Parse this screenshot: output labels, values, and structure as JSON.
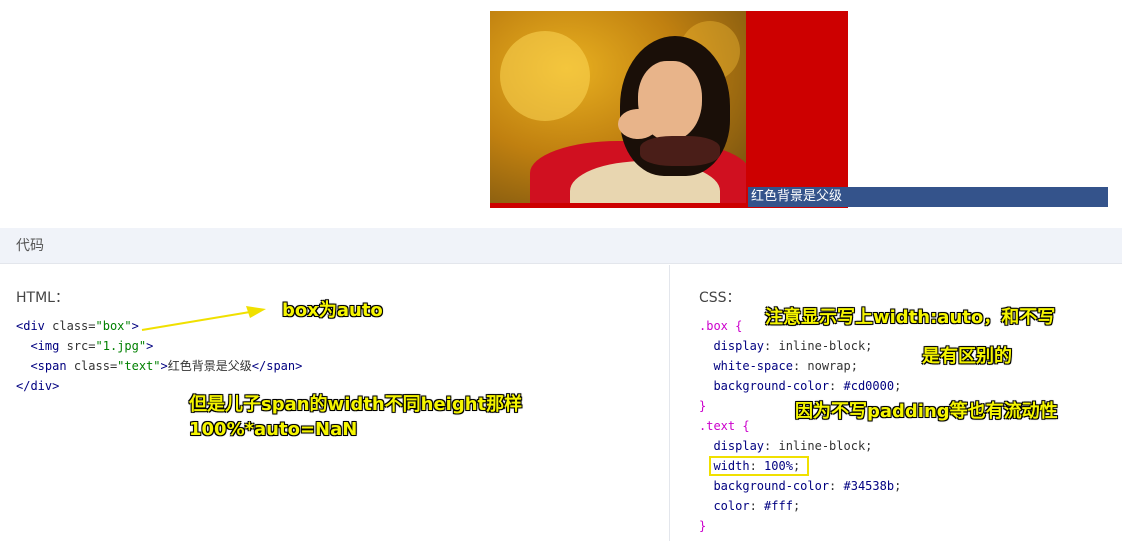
{
  "demo": {
    "span_text": "红色背景是父级"
  },
  "code_header": {
    "label": "代码"
  },
  "html_pane": {
    "title": "HTML：",
    "lines": [
      [
        "<div class=\"box\">"
      ],
      [
        "  <img src=\"1.jpg\">"
      ],
      [
        "  <span class=\"text\">红色背景是父级</span>"
      ],
      [
        "</div>"
      ]
    ]
  },
  "css_pane": {
    "title": "CSS："
  },
  "annotations": {
    "box_auto": "box为auto",
    "span_width_1": "但是儿子span的width不同height那样",
    "span_width_2": "100%*auto=NaN",
    "width_auto_note_1": "注意显示写上width:auto，和不写",
    "width_auto_note_2": "是有区别的",
    "padding_note": "因为不写padding等也有流动性"
  },
  "colors": {
    "parent_bg": "#cd0000",
    "span_bg": "#34538b",
    "highlight": "#f0e000"
  }
}
